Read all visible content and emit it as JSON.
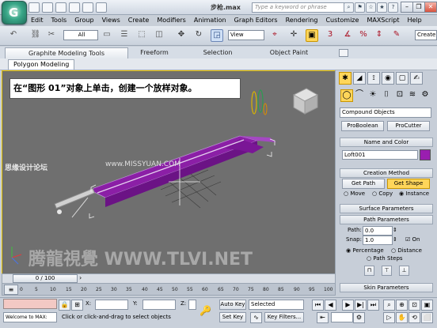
{
  "app": {
    "logo_letter": "G",
    "document_title": "步枪.max",
    "search_placeholder": "Type a keyword or phrase"
  },
  "menu": [
    "Edit",
    "Tools",
    "Group",
    "Views",
    "Create",
    "Modifiers",
    "Animation",
    "Graph Editors",
    "Rendering",
    "Customize",
    "MAXScript",
    "Help"
  ],
  "toolbar": {
    "selection_filter": "All",
    "reference_coord": "View",
    "create_selection_set": "Create"
  },
  "ribbon": {
    "tabs": [
      "Graphite Modeling Tools",
      "Freeform",
      "Selection",
      "Object Paint"
    ],
    "subtab": "Polygon Modeling"
  },
  "viewport": {
    "callout_text": "在“图形 01”对象上单击，创建一个放样对象。",
    "watermark_left": "思缘设计论坛",
    "watermark_site": "www.MISSYUAN.COM",
    "watermark_bottom": "腾龍視覺 WWW.TLVI.NET",
    "accent_color": "#8b1fa6",
    "border_color": "#e9c300"
  },
  "command_panel": {
    "category": "Compound Objects",
    "buttons": {
      "proboolean": "ProBoolean",
      "procutter": "ProCutter"
    },
    "name_and_color": {
      "header": "Name and Color",
      "name": "Loft001",
      "color": "#9a1eb0"
    },
    "creation_method": {
      "header": "Creation Method",
      "get_path": "Get Path",
      "get_shape": "Get Shape",
      "move": "Move",
      "copy": "Copy",
      "instance": "Instance"
    },
    "surface_parameters": "Surface Parameters",
    "path_parameters": {
      "header": "Path Parameters",
      "path_label": "Path:",
      "path_value": "0.0",
      "snap_label": "Snap:",
      "snap_value": "1.0",
      "on_label": "On",
      "percentage": "Percentage",
      "distance": "Distance",
      "path_steps": "Path Steps"
    },
    "skin_parameters": "Skin Parameters"
  },
  "timeline": {
    "frame": "0 / 100",
    "ticks": [
      "0",
      "5",
      "10",
      "15",
      "20",
      "25",
      "30",
      "35",
      "40",
      "45",
      "50",
      "55",
      "60",
      "65",
      "70",
      "75",
      "80",
      "85",
      "90",
      "95",
      "100"
    ]
  },
  "status": {
    "maxscript_listener": "Welcome to MAX:",
    "prompt": "Click or click-and-drag to select objects",
    "x_label": "X:",
    "y_label": "Y:",
    "z_label": "Z:",
    "auto_key": "Auto Key",
    "set_key": "Set Key",
    "selected": "Selected",
    "key_filters": "Key Filters..."
  }
}
